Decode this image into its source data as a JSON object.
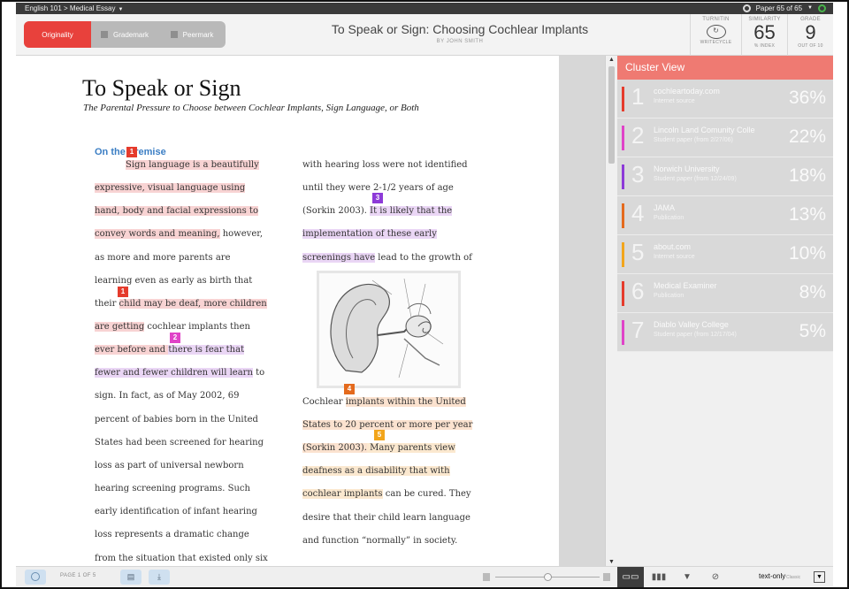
{
  "topbar": {
    "breadcrumb": "English 101 > Medical Essay",
    "paper_nav": "Paper 65 of 65"
  },
  "header": {
    "modes": [
      {
        "label": "Originality",
        "active": true
      },
      {
        "label": "Grademark",
        "active": false
      },
      {
        "label": "Peermark",
        "active": false
      }
    ],
    "title": "To Speak or Sign: Choosing Cochlear Implants",
    "author": "BY JOHN SMITH",
    "turnitin": {
      "label": "TURNITIN",
      "sub": "WRITECYCLE"
    },
    "similarity": {
      "label": "SIMILARITY",
      "value": "65",
      "sub": "% INDEX"
    },
    "grade": {
      "label": "GRADE",
      "value": "9",
      "sub": "OUT OF 10"
    }
  },
  "essay": {
    "title": "To Speak or Sign",
    "subtitle": "The Parental Pressure to Choose between Cochlear Implants, Sign Language, or Both",
    "section_heading": "On the Premise",
    "left_lines": [
      "Sign language is a beautifully",
      "expressive, visual language using",
      "hand, body and facial expressions to",
      "convey words and meaning,",
      " however,",
      "as more and more parents are",
      "learning even as early as birth that",
      "their ",
      "child may be deaf, more children",
      "are getting",
      " cochlear implants then",
      "ever before and ",
      "there is fear that",
      "fewer and fewer children will learn",
      " to",
      "sign.   In fact, as of May 2002, 69",
      "percent of babies born in the United",
      "States had been screened for hearing",
      "loss as part of universal newborn",
      "hearing screening programs. Such",
      "early identification of infant hearing",
      "loss represents a dramatic change",
      "from the situation that existed only six"
    ],
    "right_lines": [
      "with hearing loss were not identified",
      "until they were 2-1/2 years of age",
      "(Sorkin 2003). ",
      "It is likely that the",
      "implementation of these early",
      "screenings have",
      " lead to the growth of",
      "Cochlear ",
      "implants within the United",
      "States to 20 percent or more per year",
      "(Sorkin 2003).",
      " Many parents view",
      "deafness as a disability that with",
      "cochlear implants",
      " can be cured.  They",
      "desire that their child learn language",
      "and function “normally” in society."
    ],
    "markers": [
      "1",
      "1",
      "2",
      "3",
      "4",
      "5"
    ]
  },
  "cluster": {
    "heading": "Cluster View",
    "matches": [
      {
        "num": "1",
        "source": "cochleartoday.com",
        "type": "Internet source",
        "pct": "36%",
        "color": "#e53b2c"
      },
      {
        "num": "2",
        "source": "Lincoln Land Comunity Colle",
        "type": "Student paper (from 2/27/06)",
        "pct": "22%",
        "color": "#e043c8"
      },
      {
        "num": "3",
        "source": "Norwich University",
        "type": "Student paper (from 12/24/09)",
        "pct": "18%",
        "color": "#8d3ad8"
      },
      {
        "num": "4",
        "source": "JAMA",
        "type": "Publication",
        "pct": "13%",
        "color": "#e46a1d"
      },
      {
        "num": "5",
        "source": "about.com",
        "type": "Internet source",
        "pct": "10%",
        "color": "#f2a51b"
      },
      {
        "num": "6",
        "source": "Medical Examiner",
        "type": "Publication",
        "pct": "8%",
        "color": "#e53b2c"
      },
      {
        "num": "7",
        "source": "Diablo Valley College",
        "type": "Student paper (from 12/17/04)",
        "pct": "5%",
        "color": "#e043c8"
      }
    ]
  },
  "bottombar": {
    "page_label": "PAGE 1 OF 5"
  },
  "panelbar": {
    "text_only": "text-only",
    "classic": "Classic"
  }
}
